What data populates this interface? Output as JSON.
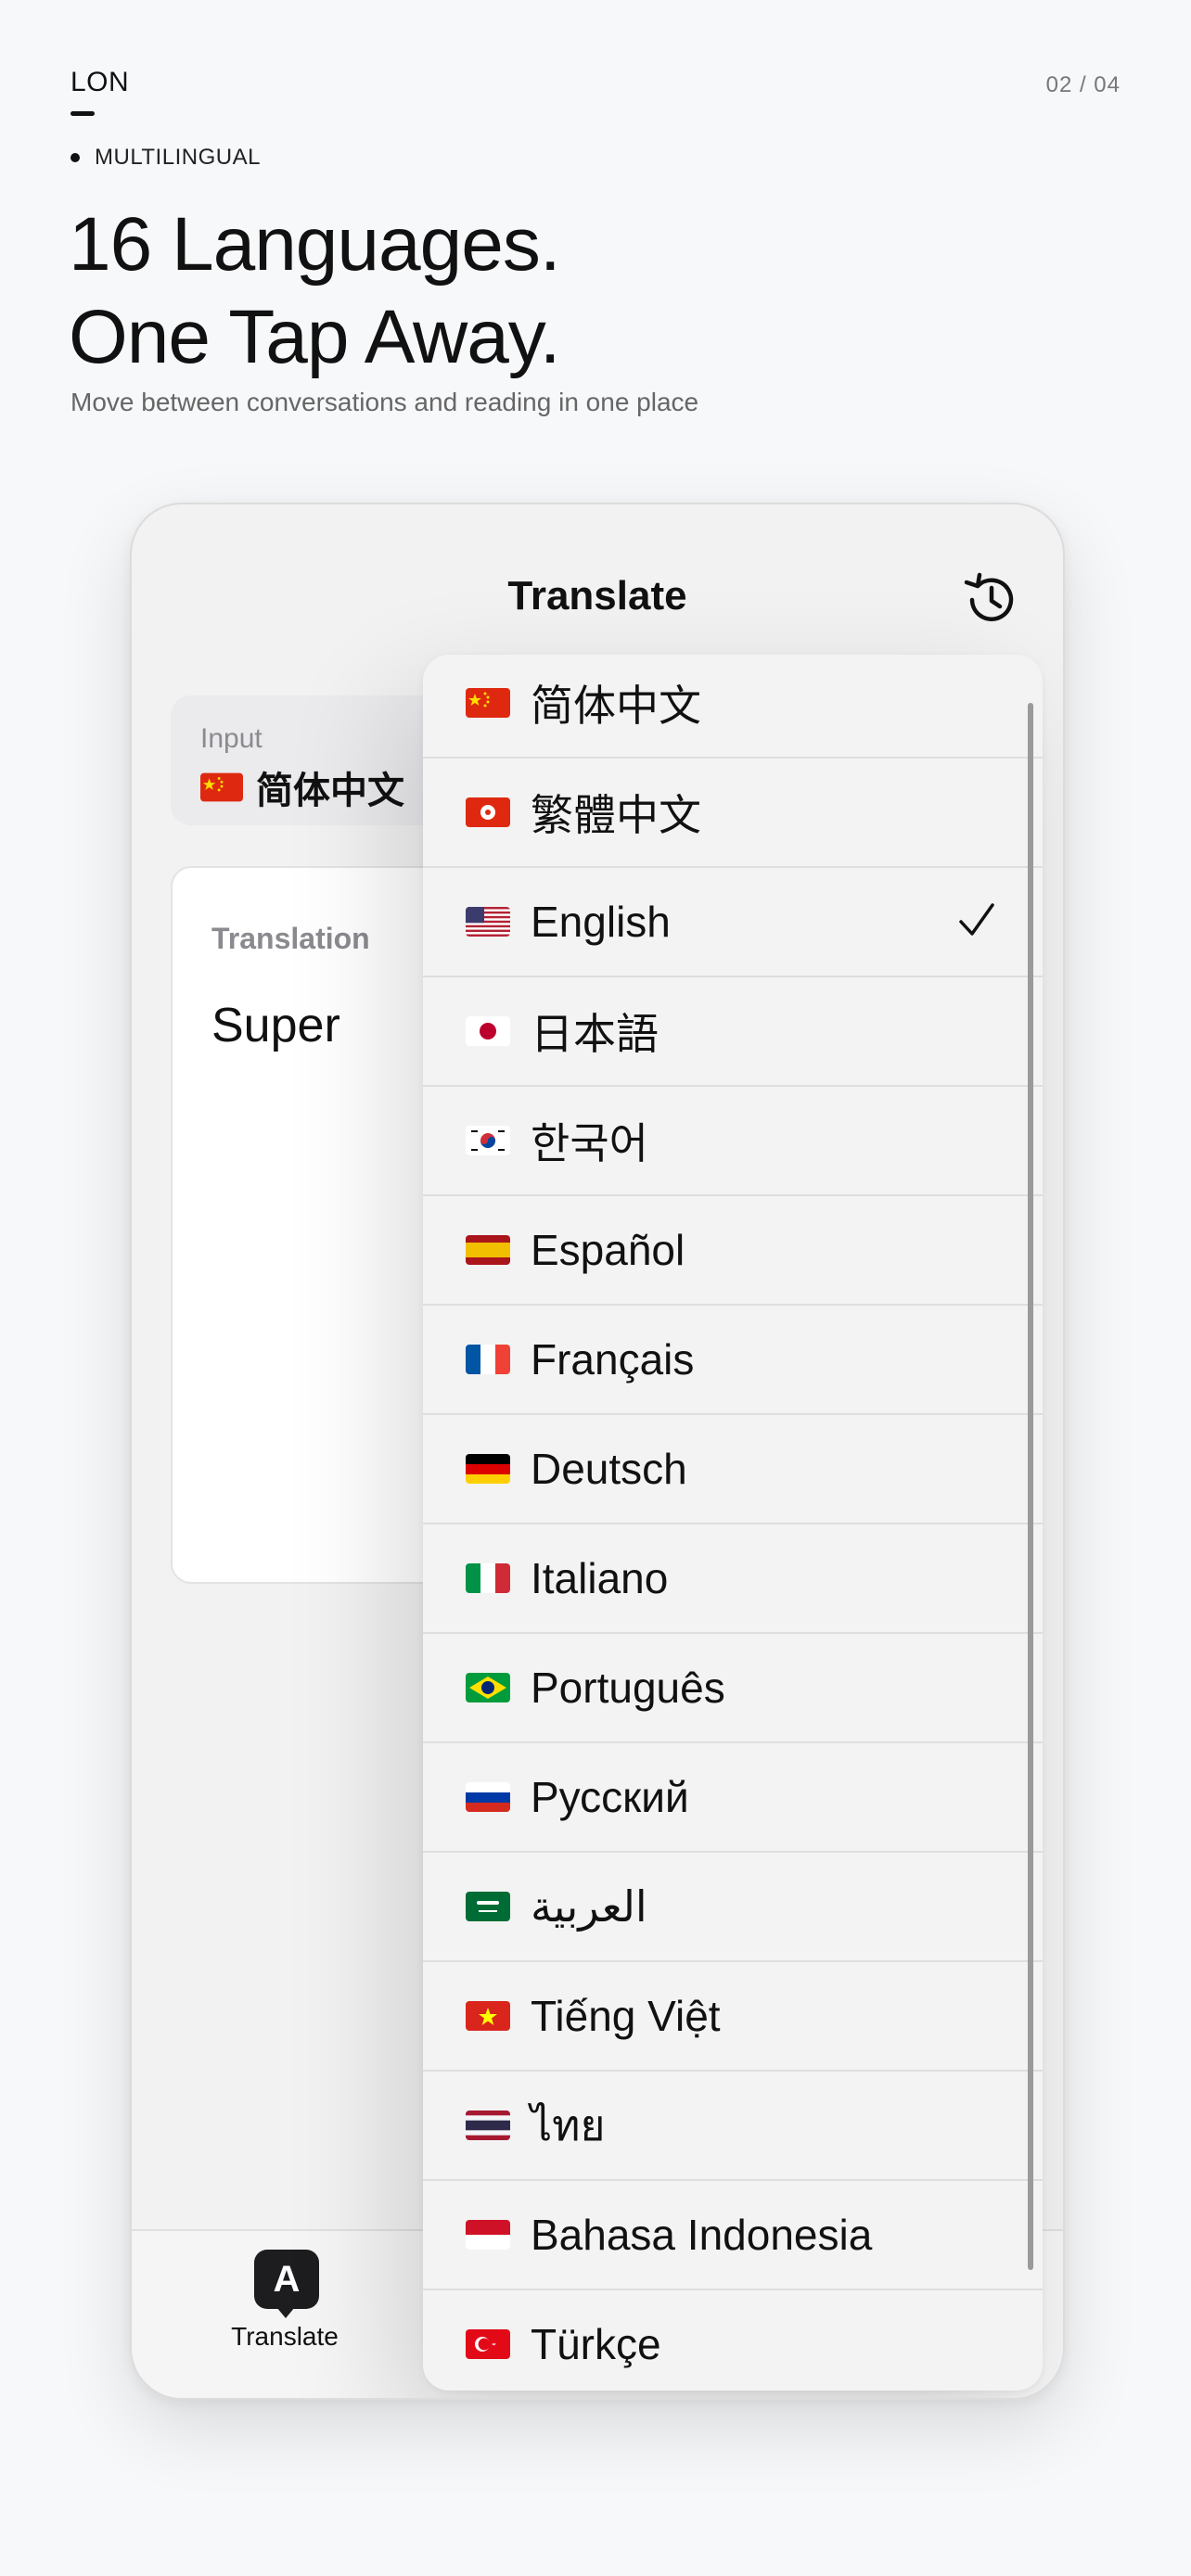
{
  "header": {
    "brand": "LON",
    "pager": "02 / 04",
    "tag": "MULTILINGUAL",
    "headline_line1": "16 Languages.",
    "headline_line2": "One Tap Away.",
    "subtitle": "Move between conversations and reading in one place"
  },
  "app": {
    "nav_title": "Translate",
    "history_icon": "history-clock-icon",
    "input": {
      "label": "Input",
      "language": "简体中文",
      "flag": "cn"
    },
    "translation": {
      "label": "Translation",
      "text": "Super"
    },
    "tabbar": {
      "tab_label": "Translate",
      "tab_icon_letter": "A"
    }
  },
  "language_menu": {
    "selected": "English",
    "items": [
      {
        "name": "简体中文",
        "flag": "cn"
      },
      {
        "name": "繁體中文",
        "flag": "hk"
      },
      {
        "name": "English",
        "flag": "us"
      },
      {
        "name": "日本語",
        "flag": "jp"
      },
      {
        "name": "한국어",
        "flag": "kr"
      },
      {
        "name": "Español",
        "flag": "es"
      },
      {
        "name": "Français",
        "flag": "fr"
      },
      {
        "name": "Deutsch",
        "flag": "de"
      },
      {
        "name": "Italiano",
        "flag": "it"
      },
      {
        "name": "Português",
        "flag": "br"
      },
      {
        "name": "Русский",
        "flag": "ru"
      },
      {
        "name": "العربية",
        "flag": "sa"
      },
      {
        "name": "Tiếng Việt",
        "flag": "vn"
      },
      {
        "name": "ไทย",
        "flag": "th"
      },
      {
        "name": "Bahasa Indonesia",
        "flag": "id"
      },
      {
        "name": "Türkçe",
        "flag": "tr"
      }
    ]
  }
}
